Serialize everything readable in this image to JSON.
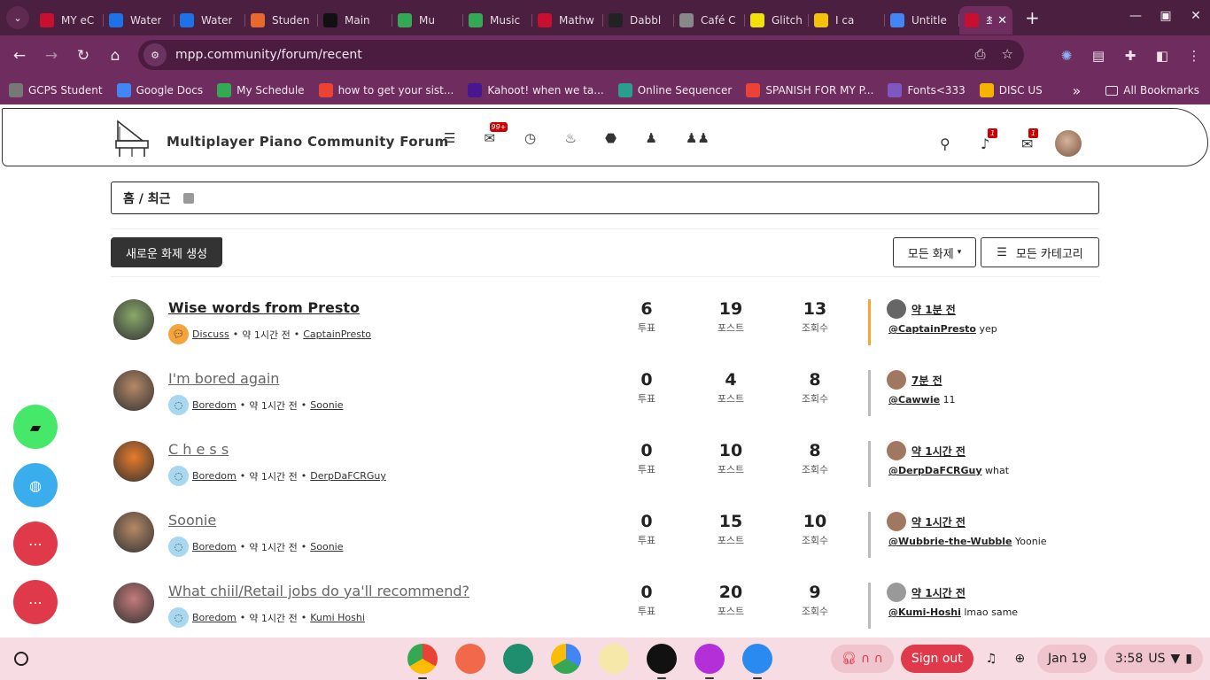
{
  "browser": {
    "tabs": [
      {
        "label": "MY eC",
        "icon": "canvas-icon",
        "color": "#c8102e"
      },
      {
        "label": "Water",
        "icon": "g-icon",
        "color": "#1a73e8"
      },
      {
        "label": "Water",
        "icon": "g-icon",
        "color": "#1a73e8"
      },
      {
        "label": "Studen",
        "icon": "pinwheel-icon",
        "color": "#e9692c"
      },
      {
        "label": "Main",
        "icon": "d2l-icon",
        "color": "#111111"
      },
      {
        "label": "Mu",
        "icon": "drive-icon",
        "color": "#34a853"
      },
      {
        "label": "Music",
        "icon": "drive-icon",
        "color": "#34a853"
      },
      {
        "label": "Mathw",
        "icon": "mathway-icon",
        "color": "#c8102e"
      },
      {
        "label": "Dabbl",
        "icon": "feather-icon",
        "color": "#222222"
      },
      {
        "label": "Café C",
        "icon": "cafe-icon",
        "color": "#888888"
      },
      {
        "label": "Glitch",
        "icon": "glitch-icon",
        "color": "#f1e30a"
      },
      {
        "label": "I ca",
        "icon": "emoji-icon",
        "color": "#f4c20d"
      },
      {
        "label": "Untitle",
        "icon": "docs-icon",
        "color": "#4285f4"
      },
      {
        "label": "최",
        "icon": "mpp-icon",
        "color": "#c8102e"
      }
    ],
    "url": "mpp.community/forum/recent",
    "bookmarks": [
      {
        "label": "GCPS Student",
        "color": "#777777"
      },
      {
        "label": "Google Docs",
        "color": "#4285f4"
      },
      {
        "label": "My Schedule",
        "color": "#34a853"
      },
      {
        "label": "how to get your sist...",
        "color": "#ea4335"
      },
      {
        "label": "Kahoot! when we ta...",
        "color": "#46178f"
      },
      {
        "label": "Online Sequencer",
        "color": "#2a9d8f"
      },
      {
        "label": "SPANISH FOR MY P...",
        "color": "#ea4335"
      },
      {
        "label": "Fonts<333",
        "color": "#7e57c2"
      },
      {
        "label": "DISC US",
        "color": "#f4b400"
      }
    ],
    "overflow_label": "»",
    "all_bookmarks_label": "All Bookmarks"
  },
  "forum": {
    "brand": "Multiplayer Piano Community Forum",
    "chat_badge": "99+",
    "notif_badge": "1",
    "msg_badge": "1",
    "breadcrumb": "홈 / 최근",
    "new_topic_label": "새로운 화제 생성",
    "filter_label": "모든 화제",
    "category_label": "모든 카테고리",
    "topics": [
      {
        "title": "Wise words from Presto",
        "style": "bold",
        "category": "Discuss",
        "cat_color": "#f4a43a",
        "time": "약 1시간 전",
        "author": "CaptainPresto",
        "votes": "6",
        "posts": "19",
        "views": "13",
        "votes_label": "투표",
        "posts_label": "포스트",
        "views_label": "조회수",
        "last_time": "약 1분 전",
        "last_user": "@CaptainPresto",
        "last_text": "yep",
        "bar_color": "#f4a43a",
        "avatar_color": "#8aa86a",
        "mini_color": "#666666"
      },
      {
        "title": "I'm bored again",
        "style": "light",
        "category": "Boredom",
        "cat_color": "#a8d8f0",
        "time": "약 1시간 전",
        "author": "Soonie",
        "votes": "0",
        "posts": "4",
        "views": "8",
        "votes_label": "투표",
        "posts_label": "포스트",
        "views_label": "조회수",
        "last_time": "7분 전",
        "last_user": "@Cawwie",
        "last_text": "11",
        "bar_color": "#bbbbbb",
        "avatar_color": "#b58866",
        "mini_color": "#a07860"
      },
      {
        "title": "C h e s s",
        "style": "light",
        "category": "Boredom",
        "cat_color": "#a8d8f0",
        "time": "약 1시간 전",
        "author": "DerpDaFCRGuy",
        "votes": "0",
        "posts": "10",
        "views": "8",
        "votes_label": "투표",
        "posts_label": "포스트",
        "views_label": "조회수",
        "last_time": "약 1시간 전",
        "last_user": "@DerpDaFCRGuy",
        "last_text": "what",
        "bar_color": "#bbbbbb",
        "avatar_color": "#e87b2a",
        "mini_color": "#a07860"
      },
      {
        "title": "Soonie",
        "style": "light",
        "category": "Boredom",
        "cat_color": "#a8d8f0",
        "time": "약 1시간 전",
        "author": "Soonie",
        "votes": "0",
        "posts": "15",
        "views": "10",
        "votes_label": "투표",
        "posts_label": "포스트",
        "views_label": "조회수",
        "last_time": "약 1시간 전",
        "last_user": "@Wubbrie-the-Wubble",
        "last_text": "Yoonie",
        "bar_color": "#bbbbbb",
        "avatar_color": "#b58866",
        "mini_color": "#a07860"
      },
      {
        "title": "What chiil/Retail jobs do ya'll recommend?",
        "style": "light",
        "category": "Boredom",
        "cat_color": "#a8d8f0",
        "time": "약 1시간 전",
        "author": "Kumi Hoshi",
        "votes": "0",
        "posts": "20",
        "views": "9",
        "votes_label": "투표",
        "posts_label": "포스트",
        "views_label": "조회수",
        "last_time": "약 1시간 전",
        "last_user": "@Kumi-Hoshi",
        "last_text": "lmao same",
        "bar_color": "#bbbbbb",
        "avatar_color": "#c47a7a",
        "mini_color": "#999999"
      }
    ]
  },
  "fabs": [
    {
      "icon": "folder-icon",
      "color": "#46e86a"
    },
    {
      "icon": "globe-icon",
      "color": "#3aaeec"
    },
    {
      "icon": "chat-icon",
      "color": "#e03a4a"
    },
    {
      "icon": "chat-icon",
      "color": "#e03a4a"
    }
  ],
  "shelf": {
    "sign_out_label": "Sign out",
    "date": "Jan 19",
    "time": "3:58",
    "locale": "US"
  }
}
